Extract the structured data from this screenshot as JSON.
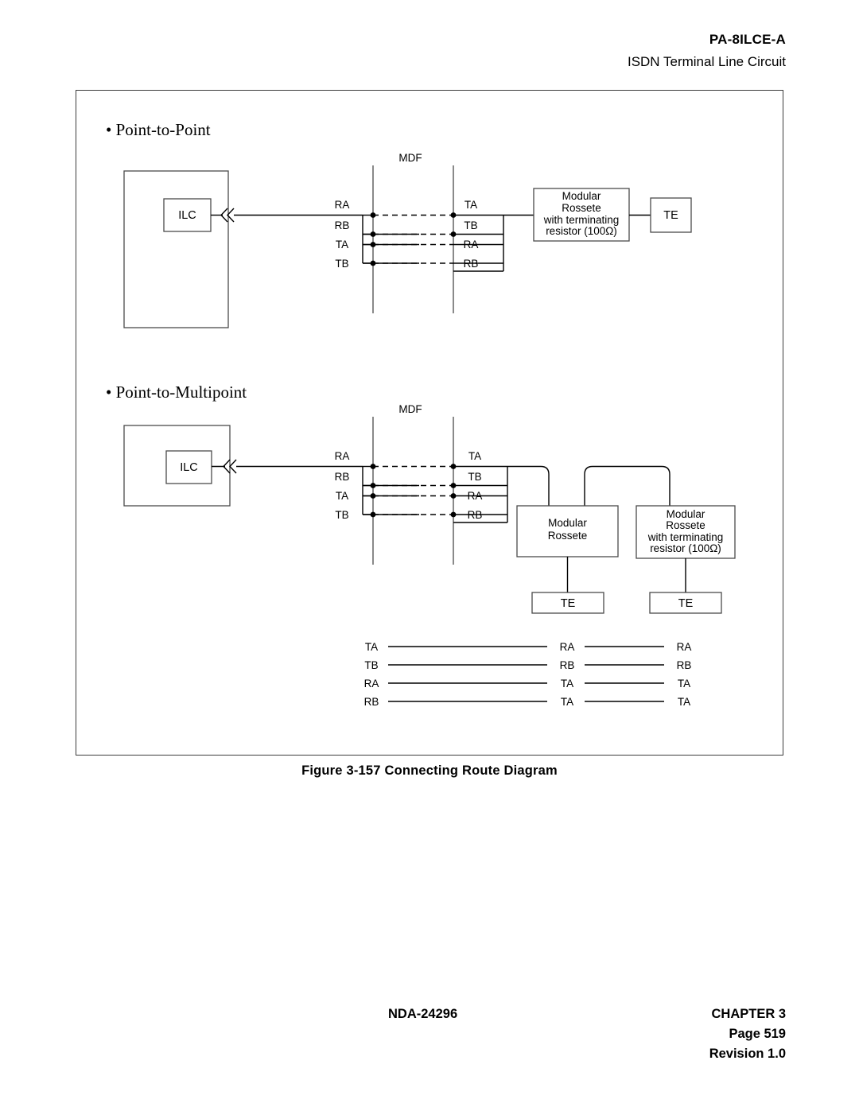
{
  "header": {
    "product_code": "PA-8ILCE-A",
    "subtitle": "ISDN Terminal Line Circuit"
  },
  "figure": {
    "caption": "Figure 3-157   Connecting Route Diagram",
    "sections": {
      "point_to_point": "• Point-to-Point",
      "point_to_multipoint": "• Point-to-Multipoint"
    }
  },
  "diagram_top": {
    "title": "Point-to-Point",
    "mdf_label": "MDF",
    "ilc_label": "ILC",
    "connector_glyph": "«",
    "left_pairs": [
      "RA",
      "RB",
      "TA",
      "TB"
    ],
    "right_pairs": [
      "TA",
      "TB",
      "RA",
      "RB"
    ],
    "rossete": {
      "line1": "Modular",
      "line2": "Rossete",
      "line3": "with terminating",
      "line4": "resistor (100Ω)"
    },
    "te_label": "TE"
  },
  "diagram_bottom": {
    "title": "Point-to-Multipoint",
    "mdf_label": "MDF",
    "ilc_label": "ILC",
    "connector_glyph": "«",
    "left_pairs": [
      "RA",
      "RB",
      "TA",
      "TB"
    ],
    "right_pairs": [
      "TA",
      "TB",
      "RA",
      "RB"
    ],
    "rossete_plain": {
      "line1": "Modular",
      "line2": "Rossete"
    },
    "rossete_terminated": {
      "line1": "Modular",
      "line2": "Rossete",
      "line3": "with terminating",
      "line4": "resistor (100Ω)"
    },
    "te_label_left": "TE",
    "te_label_right": "TE",
    "wiring_table": {
      "col1": [
        "TA",
        "TB",
        "RA",
        "RB"
      ],
      "col2": [
        "RA",
        "RB",
        "TA",
        "TA"
      ],
      "col3": [
        "RA",
        "RB",
        "TA",
        "TA"
      ]
    }
  },
  "footer": {
    "document_number": "NDA-24296",
    "chapter": "CHAPTER 3",
    "page": "Page 519",
    "revision": "Revision 1.0"
  }
}
